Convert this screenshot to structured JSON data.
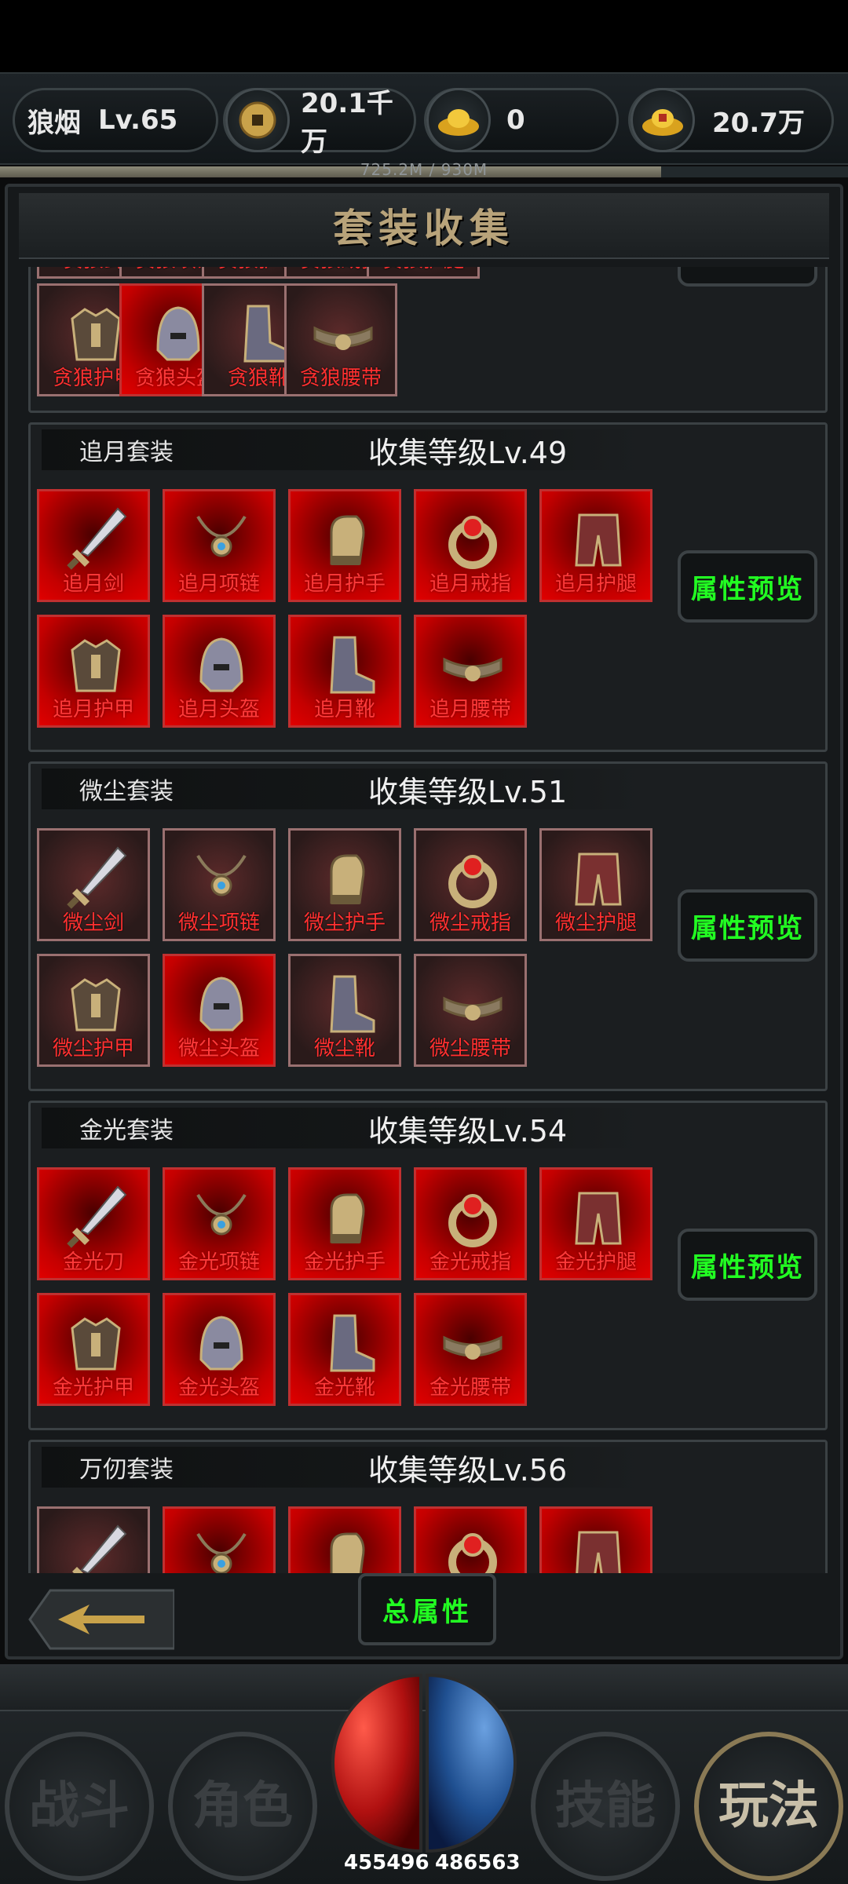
{
  "header": {
    "player_name": "狼烟",
    "player_level": "Lv.65",
    "copper_amount": "20.1千万",
    "gold_ingot_amount": "0",
    "silver_ingot_amount": "20.7万",
    "xp_text": "725.2M / 930M",
    "xp_fraction": 0.78
  },
  "panel": {
    "title": "套装收集",
    "preview_label": "属性预览",
    "total_label": "总属性"
  },
  "partial_set": {
    "top_labels": [
      "贪狼剑",
      "贪狼项链",
      "贪狼护手",
      "贪狼戒指",
      "贪狼护腿"
    ],
    "items": [
      {
        "label": "贪狼护甲",
        "owned": false
      },
      {
        "label": "贪狼头盔",
        "owned": true
      },
      {
        "label": "贪狼靴",
        "owned": false
      },
      {
        "label": "贪狼腰带",
        "owned": false
      }
    ]
  },
  "sets": [
    {
      "name": "追月套装",
      "level": "收集等级Lv.49",
      "items": [
        {
          "label": "追月剑",
          "owned": true
        },
        {
          "label": "追月项链",
          "owned": true
        },
        {
          "label": "追月护手",
          "owned": true
        },
        {
          "label": "追月戒指",
          "owned": true
        },
        {
          "label": "追月护腿",
          "owned": true
        },
        {
          "label": "追月护甲",
          "owned": true
        },
        {
          "label": "追月头盔",
          "owned": true
        },
        {
          "label": "追月靴",
          "owned": true
        },
        {
          "label": "追月腰带",
          "owned": true
        }
      ]
    },
    {
      "name": "微尘套装",
      "level": "收集等级Lv.51",
      "items": [
        {
          "label": "微尘剑",
          "owned": false
        },
        {
          "label": "微尘项链",
          "owned": false
        },
        {
          "label": "微尘护手",
          "owned": false
        },
        {
          "label": "微尘戒指",
          "owned": false
        },
        {
          "label": "微尘护腿",
          "owned": false
        },
        {
          "label": "微尘护甲",
          "owned": false
        },
        {
          "label": "微尘头盔",
          "owned": true
        },
        {
          "label": "微尘靴",
          "owned": false
        },
        {
          "label": "微尘腰带",
          "owned": false
        }
      ]
    },
    {
      "name": "金光套装",
      "level": "收集等级Lv.54",
      "items": [
        {
          "label": "金光刀",
          "owned": true
        },
        {
          "label": "金光项链",
          "owned": true
        },
        {
          "label": "金光护手",
          "owned": true
        },
        {
          "label": "金光戒指",
          "owned": true
        },
        {
          "label": "金光护腿",
          "owned": true
        },
        {
          "label": "金光护甲",
          "owned": true
        },
        {
          "label": "金光头盔",
          "owned": true
        },
        {
          "label": "金光靴",
          "owned": true
        },
        {
          "label": "金光腰带",
          "owned": true
        }
      ]
    },
    {
      "name": "万仞套装",
      "level": "收集等级Lv.56"
    }
  ],
  "bottom_nav": {
    "battle": "战斗",
    "character": "角色",
    "skills": "技能",
    "gameplay": "玩法",
    "hp": "455496",
    "mp": "486563"
  },
  "colors": {
    "accent_green": "#22ff22",
    "owned_red": "#c40000",
    "label_red": "#ff3030",
    "title_gold": "#b8a37a"
  }
}
